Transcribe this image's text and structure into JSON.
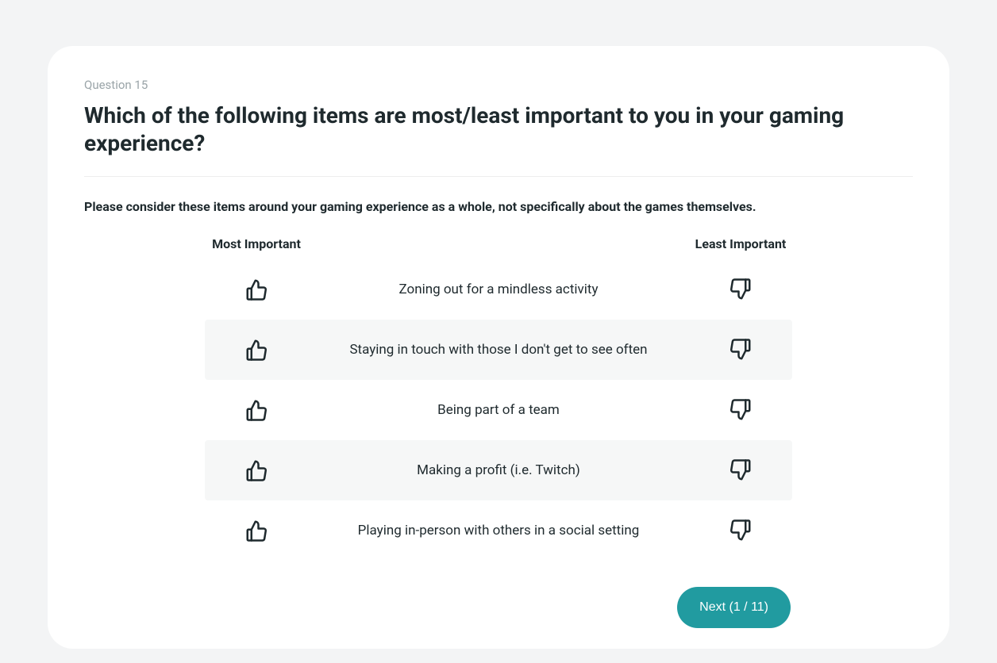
{
  "question": {
    "number_label": "Question 15",
    "title": "Which of the following items are most/least important to you in your gaming experience?",
    "instruction": "Please consider these items around your gaming experience as a whole, not specifically about the games themselves."
  },
  "columns": {
    "most_label": "Most Important",
    "least_label": "Least Important"
  },
  "items": [
    {
      "label": "Zoning out for a mindless activity"
    },
    {
      "label": "Staying in touch with those I don't get to see often"
    },
    {
      "label": "Being part of a team"
    },
    {
      "label": "Making a profit (i.e. Twitch)"
    },
    {
      "label": "Playing in-person with others in a social setting"
    }
  ],
  "footer": {
    "next_label": "Next (1 / 11)"
  },
  "colors": {
    "accent": "#219ba0",
    "muted": "#9aa4a8",
    "text": "#1f2a2e",
    "row_alt": "#f6f7f7"
  }
}
